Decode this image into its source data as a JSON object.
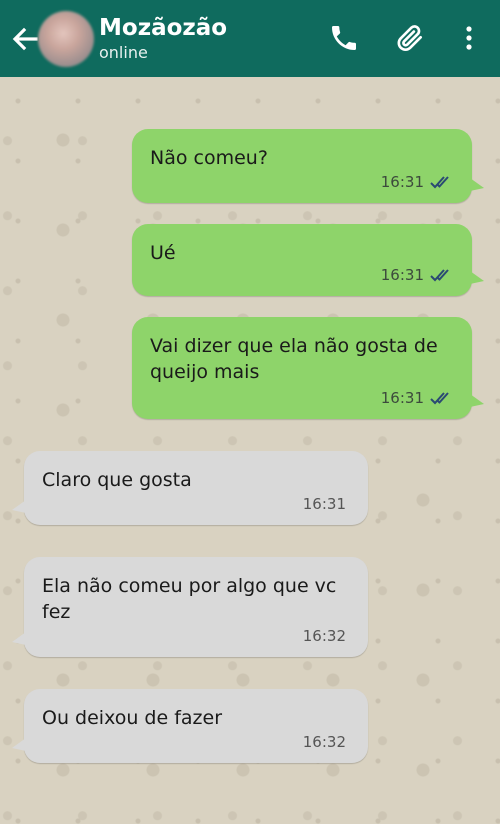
{
  "header": {
    "contact_name": "Mozãozão",
    "status": "online",
    "icons": [
      "back-arrow-icon",
      "phone-icon",
      "paperclip-icon",
      "more-vert-icon"
    ],
    "colors": {
      "bar": "#0f6b5e",
      "outgoing": "#8ed46a",
      "incoming": "#d9d9d9",
      "read_tick": "#2b4a73"
    }
  },
  "messages": [
    {
      "direction": "outgoing",
      "text": "Não comeu?",
      "time": "16:31",
      "read": true
    },
    {
      "direction": "outgoing",
      "text": "Ué",
      "time": "16:31",
      "read": true
    },
    {
      "direction": "outgoing",
      "text": "Vai dizer que ela não gosta de queijo mais",
      "time": "16:31",
      "read": true
    },
    {
      "direction": "incoming",
      "text": "Claro que gosta",
      "time": "16:31"
    },
    {
      "direction": "incoming",
      "text": "Ela não comeu por algo que vc fez",
      "time": "16:32"
    },
    {
      "direction": "incoming",
      "text": "Ou deixou de fazer",
      "time": "16:32"
    }
  ]
}
